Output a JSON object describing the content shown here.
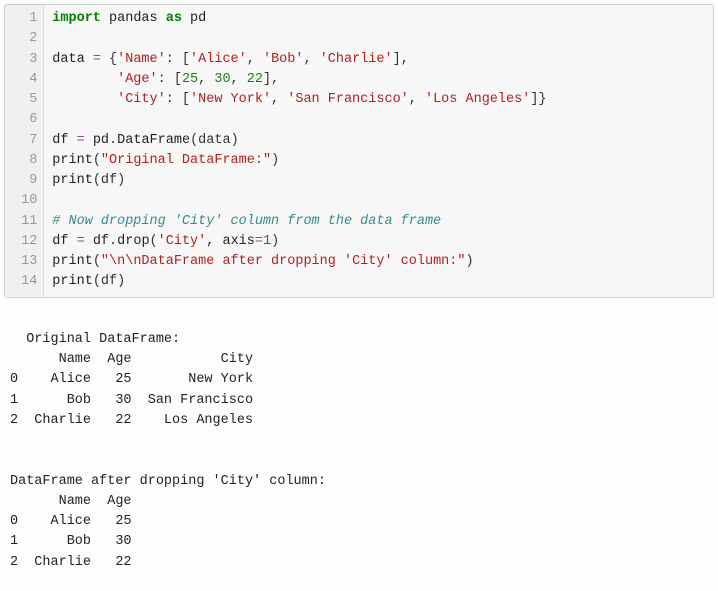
{
  "code": {
    "lines": [
      {
        "n": "1",
        "tokens": [
          {
            "t": "import",
            "c": "tok-kw"
          },
          {
            "t": " ",
            "c": ""
          },
          {
            "t": "pandas",
            "c": "tok-id"
          },
          {
            "t": " ",
            "c": ""
          },
          {
            "t": "as",
            "c": "tok-kw"
          },
          {
            "t": " ",
            "c": ""
          },
          {
            "t": "pd",
            "c": "tok-id"
          }
        ]
      },
      {
        "n": "2",
        "tokens": []
      },
      {
        "n": "3",
        "tokens": [
          {
            "t": "data ",
            "c": "tok-id"
          },
          {
            "t": "=",
            "c": "tok-op"
          },
          {
            "t": " {",
            "c": "tok-pun"
          },
          {
            "t": "'Name'",
            "c": "tok-str"
          },
          {
            "t": ": [",
            "c": "tok-pun"
          },
          {
            "t": "'Alice'",
            "c": "tok-str"
          },
          {
            "t": ", ",
            "c": "tok-pun"
          },
          {
            "t": "'Bob'",
            "c": "tok-str"
          },
          {
            "t": ", ",
            "c": "tok-pun"
          },
          {
            "t": "'Charlie'",
            "c": "tok-str"
          },
          {
            "t": "],",
            "c": "tok-pun"
          }
        ]
      },
      {
        "n": "4",
        "tokens": [
          {
            "t": "        ",
            "c": ""
          },
          {
            "t": "'Age'",
            "c": "tok-str"
          },
          {
            "t": ": [",
            "c": "tok-pun"
          },
          {
            "t": "25",
            "c": "tok-num"
          },
          {
            "t": ", ",
            "c": "tok-pun"
          },
          {
            "t": "30",
            "c": "tok-num"
          },
          {
            "t": ", ",
            "c": "tok-pun"
          },
          {
            "t": "22",
            "c": "tok-num"
          },
          {
            "t": "],",
            "c": "tok-pun"
          }
        ]
      },
      {
        "n": "5",
        "tokens": [
          {
            "t": "        ",
            "c": ""
          },
          {
            "t": "'City'",
            "c": "tok-str"
          },
          {
            "t": ": [",
            "c": "tok-pun"
          },
          {
            "t": "'New York'",
            "c": "tok-str"
          },
          {
            "t": ", ",
            "c": "tok-pun"
          },
          {
            "t": "'San Francisco'",
            "c": "tok-str"
          },
          {
            "t": ", ",
            "c": "tok-pun"
          },
          {
            "t": "'Los Angeles'",
            "c": "tok-str"
          },
          {
            "t": "]}",
            "c": "tok-pun"
          }
        ]
      },
      {
        "n": "6",
        "tokens": []
      },
      {
        "n": "7",
        "tokens": [
          {
            "t": "df ",
            "c": "tok-id"
          },
          {
            "t": "=",
            "c": "tok-op"
          },
          {
            "t": " pd",
            "c": "tok-id"
          },
          {
            "t": ".",
            "c": "tok-pun"
          },
          {
            "t": "DataFrame",
            "c": "tok-fn"
          },
          {
            "t": "(data)",
            "c": "tok-pun"
          }
        ]
      },
      {
        "n": "8",
        "tokens": [
          {
            "t": "print",
            "c": "tok-fn"
          },
          {
            "t": "(",
            "c": "tok-pun"
          },
          {
            "t": "\"Original DataFrame:\"",
            "c": "tok-str"
          },
          {
            "t": ")",
            "c": "tok-pun"
          }
        ]
      },
      {
        "n": "9",
        "tokens": [
          {
            "t": "print",
            "c": "tok-fn"
          },
          {
            "t": "(df)",
            "c": "tok-pun"
          }
        ]
      },
      {
        "n": "10",
        "tokens": []
      },
      {
        "n": "11",
        "tokens": [
          {
            "t": "# Now dropping 'City' column from the data frame",
            "c": "tok-cmt"
          }
        ]
      },
      {
        "n": "12",
        "tokens": [
          {
            "t": "df ",
            "c": "tok-id"
          },
          {
            "t": "=",
            "c": "tok-op"
          },
          {
            "t": " df",
            "c": "tok-id"
          },
          {
            "t": ".",
            "c": "tok-pun"
          },
          {
            "t": "drop",
            "c": "tok-fn"
          },
          {
            "t": "(",
            "c": "tok-pun"
          },
          {
            "t": "'City'",
            "c": "tok-str"
          },
          {
            "t": ", axis",
            "c": "tok-id"
          },
          {
            "t": "=",
            "c": "tok-op"
          },
          {
            "t": "1",
            "c": "tok-num"
          },
          {
            "t": ")",
            "c": "tok-pun"
          }
        ]
      },
      {
        "n": "13",
        "tokens": [
          {
            "t": "print",
            "c": "tok-fn"
          },
          {
            "t": "(",
            "c": "tok-pun"
          },
          {
            "t": "\"\\n\\nDataFrame after dropping 'City' column:\"",
            "c": "tok-str"
          },
          {
            "t": ")",
            "c": "tok-pun"
          }
        ]
      },
      {
        "n": "14",
        "tokens": [
          {
            "t": "print",
            "c": "tok-fn"
          },
          {
            "t": "(df)",
            "c": "tok-pun"
          }
        ]
      }
    ]
  },
  "output": {
    "text": "Original DataFrame:\n      Name  Age           City\n0    Alice   25       New York\n1      Bob   30  San Francisco\n2  Charlie   22    Los Angeles\n\n\nDataFrame after dropping 'City' column:\n      Name  Age\n0    Alice   25\n1      Bob   30\n2  Charlie   22"
  },
  "chart_data": {
    "type": "table",
    "tables": [
      {
        "title": "Original DataFrame:",
        "columns": [
          "",
          "Name",
          "Age",
          "City"
        ],
        "rows": [
          [
            "0",
            "Alice",
            25,
            "New York"
          ],
          [
            "1",
            "Bob",
            30,
            "San Francisco"
          ],
          [
            "2",
            "Charlie",
            22,
            "Los Angeles"
          ]
        ]
      },
      {
        "title": "DataFrame after dropping 'City' column:",
        "columns": [
          "",
          "Name",
          "Age"
        ],
        "rows": [
          [
            "0",
            "Alice",
            25
          ],
          [
            "1",
            "Bob",
            30
          ],
          [
            "2",
            "Charlie",
            22
          ]
        ]
      }
    ]
  }
}
